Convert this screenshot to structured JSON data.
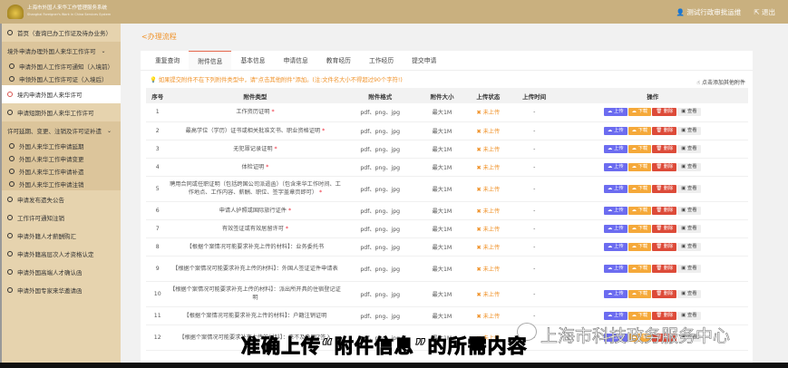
{
  "header": {
    "title": "上海市外国人来华工作管理服务系统",
    "subtitle": "Shanghai Foreigner's Work in China Services System",
    "user": "测试行政审批运维",
    "logout": "退出"
  },
  "sidebar": [
    {
      "label": "首页（查询已办工作证及待办业务）",
      "type": "item"
    },
    {
      "label": "境外申请办理外国人来华工作许可",
      "type": "group",
      "children": [
        "申请外国人工作许可通知（入境前）",
        "申领外国人工作许可证（入境后）"
      ]
    },
    {
      "label": "境内申请外国人来华许可",
      "type": "item",
      "active": true
    },
    {
      "label": "申请短期外国人来华工作许可",
      "type": "item"
    },
    {
      "label": "许可延期、变更、注销及许可证补遗",
      "type": "group",
      "children": [
        "外国人来华工作申请延期",
        "外国人来华工作申请变更",
        "外国人来华工作申请补遗",
        "外国人来华工作申请注销"
      ]
    },
    {
      "label": "申请发布遗失公告",
      "type": "item"
    },
    {
      "label": "工作许可通知注销",
      "type": "item"
    },
    {
      "label": "申请外籍人才薪酬购汇",
      "type": "item"
    },
    {
      "label": "申请外籍高层次人才资格认定",
      "type": "item"
    },
    {
      "label": "申请外国高端人才确认函",
      "type": "item"
    },
    {
      "label": "申请外国专家来华邀请函",
      "type": "item"
    }
  ],
  "main": {
    "process_title": "办理流程",
    "tabs": [
      "重复查询",
      "附件信息",
      "基本信息",
      "申请信息",
      "教育经历",
      "工作经历",
      "提交申请"
    ],
    "active_tab": 1,
    "notice": "如果提交附件不在下列附件类型中，请\"点击其他附件\"添加。(注:文件名大小不得超过90个字符!)",
    "add_other": "点击添加其他附件",
    "columns": [
      "序号",
      "附件类型",
      "附件格式",
      "附件大小",
      "上传状态",
      "上传时间",
      "操作"
    ],
    "buttons": {
      "upload": "上传",
      "download": "下载",
      "delete": "删除",
      "view": "查看"
    },
    "rows": [
      {
        "no": "1",
        "type": "工作资历证明",
        "req": true,
        "format": "pdf、png、jpg",
        "size": "最大1M",
        "status": "未上传",
        "time": "-"
      },
      {
        "no": "2",
        "type": "最高学位（学历）证书或相关批准文书、职业资格证明",
        "req": true,
        "format": "pdf、png、jpg",
        "size": "最大1M",
        "status": "未上传",
        "time": "-"
      },
      {
        "no": "3",
        "type": "无犯罪记录证明",
        "req": true,
        "format": "pdf、png、jpg",
        "size": "最大1M",
        "status": "未上传",
        "time": "-"
      },
      {
        "no": "4",
        "type": "体检证明",
        "req": true,
        "format": "pdf、png、jpg",
        "size": "最大1M",
        "status": "未上传",
        "time": "-"
      },
      {
        "no": "5",
        "type": "聘用合同或任职证明（包括跨国公司派遣函）（包含来华工作时间、工作地点、工作内容、薪酬、职位、签字盖章页即可）",
        "req": true,
        "format": "pdf、png、jpg",
        "size": "最大1M",
        "status": "未上传",
        "time": "-"
      },
      {
        "no": "6",
        "type": "申请人护照或国际旅行证件",
        "req": true,
        "format": "pdf、png、jpg",
        "size": "最大1M",
        "status": "未上传",
        "time": "-"
      },
      {
        "no": "7",
        "type": "有效签证或有效居留许可",
        "req": true,
        "format": "pdf、png、jpg",
        "size": "最大1M",
        "status": "未上传",
        "time": "-"
      },
      {
        "no": "8",
        "type": "【根据个案情况可能要求补充上传的材料】：业务委托书",
        "req": false,
        "format": "pdf、png、jpg",
        "size": "最大1M",
        "status": "未上传",
        "time": "-"
      },
      {
        "no": "9",
        "type": "【根据个案情况可能要求补充上传的材料】：外国人签证证件申请表",
        "req": false,
        "format": "pdf、png、jpg",
        "size": "最大1M",
        "status": "未上传",
        "time": "-"
      },
      {
        "no": "10",
        "type": "【根据个案情况可能要求补充上传的材料】：派出所开具的住宿登记证明",
        "req": false,
        "format": "pdf、png、jpg",
        "size": "最大1M",
        "status": "未上传",
        "time": "-"
      },
      {
        "no": "11",
        "type": "【根据个案情况可能要求补充上传的材料】：户籍注销证明",
        "req": false,
        "format": "pdf、png、jpg",
        "size": "最大1M",
        "status": "未上传",
        "time": "-"
      },
      {
        "no": "12",
        "type": "【根据个案情况可能要求补充上传的材料】：来不及办理Z签入",
        "req": false,
        "format": "pdf、png、jpg",
        "size": "最大1M",
        "status": "未上传",
        "time": "-"
      }
    ]
  },
  "overlay": {
    "subtitle": "准确上传“附件信息”的所需内容",
    "watermark": "上海市科技政务服务中心"
  }
}
